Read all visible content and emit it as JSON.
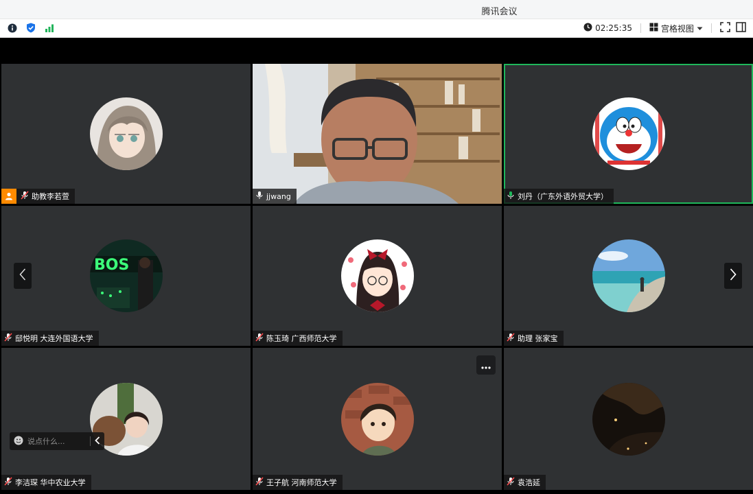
{
  "window": {
    "title": "腾讯会议"
  },
  "toolbar": {
    "left_icons": [
      "info-icon",
      "shield-icon",
      "signal-icon"
    ],
    "timer": "02:25:35",
    "view_label": "宫格视图",
    "right_icons": [
      "clock-icon",
      "grid-icon",
      "chevron-down-icon",
      "fullscreen-icon",
      "sidebar-icon"
    ]
  },
  "participants": [
    {
      "name": "助教李若萱",
      "mic": "muted",
      "host": true,
      "avatar": "anime-girl-avatar"
    },
    {
      "name": "jjwang",
      "mic": "on",
      "video": true
    },
    {
      "name": "刘丹（广东外语外贸大学）",
      "mic": "speaking",
      "active": true,
      "avatar": "doraemon-avatar"
    },
    {
      "name": "邸悦明 大连外国语大学",
      "mic": "muted",
      "avatar": "neon-avatar"
    },
    {
      "name": "陈玉琦 广西师范大学",
      "mic": "muted",
      "avatar": "cartoon-girl-avatar"
    },
    {
      "name": "助理 张家宝",
      "mic": "muted",
      "avatar": "beach-avatar"
    },
    {
      "name": "李洁琛 华中农业大学",
      "mic": "muted",
      "avatar": "photo-avatar"
    },
    {
      "name": "王子航 河南师范大学",
      "mic": "muted",
      "avatar": "illustration-avatar"
    },
    {
      "name": "袁浩延",
      "mic": "muted",
      "avatar": "night-avatar"
    }
  ],
  "chat": {
    "placeholder": "说点什么..."
  },
  "colors": {
    "active_border": "#1fb85b",
    "mic_on": "#ffffff",
    "mic_speaking": "#1fb85b",
    "host_badge": "#ff8a00"
  }
}
